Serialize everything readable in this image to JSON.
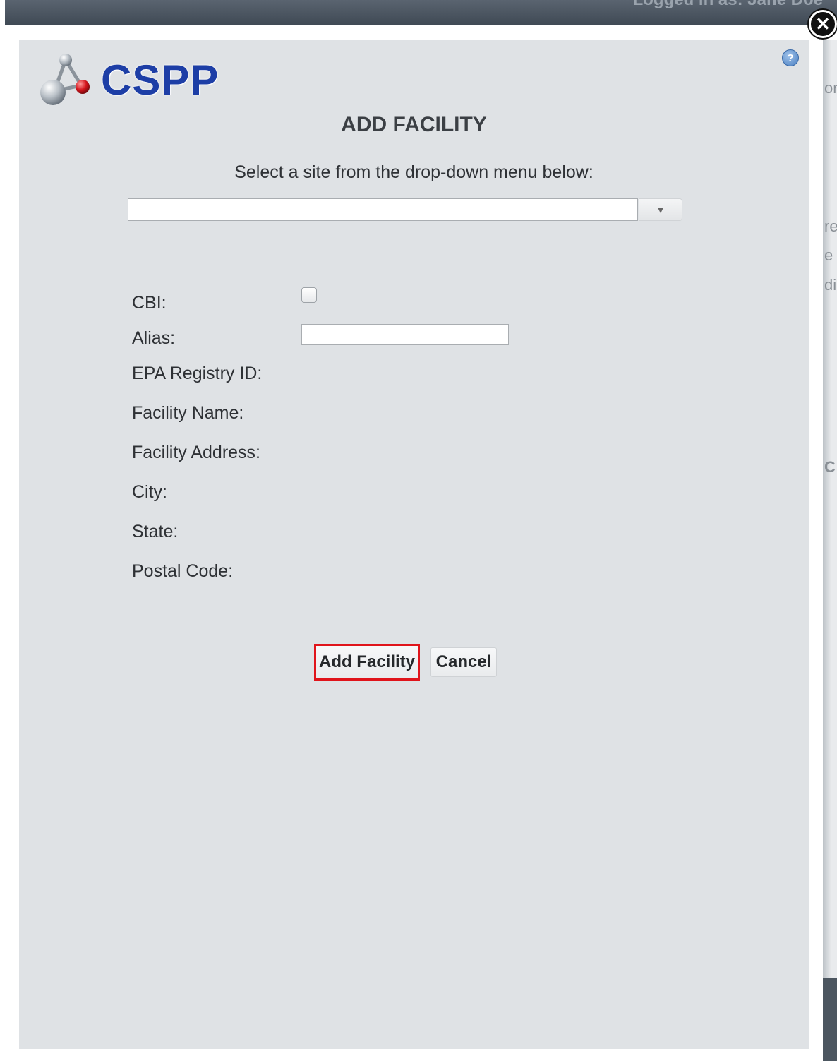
{
  "background": {
    "header_text": "Logged in as: Jane Doe",
    "edge_fragments": [
      "or",
      "re",
      "e t",
      "di",
      "C"
    ]
  },
  "modal": {
    "close_symbol": "✕",
    "help_symbol": "?",
    "logo_text": "CSPP",
    "title": "ADD FACILITY",
    "instruction": "Select a site from the drop-down menu below:",
    "site_select": {
      "value": "",
      "arrow": "▼"
    },
    "fields": {
      "cbi_label": "CBI:",
      "alias_label": "Alias:",
      "alias_value": "",
      "epa_registry_id_label": "EPA Registry ID:",
      "facility_name_label": "Facility Name:",
      "facility_address_label": "Facility Address:",
      "city_label": "City:",
      "state_label": "State:",
      "postal_code_label": "Postal Code:"
    },
    "buttons": {
      "add_label": "Add Facility",
      "cancel_label": "Cancel"
    },
    "colors": {
      "logo_blue": "#1d3ea6",
      "highlight_red": "#e0141b",
      "modal_bg": "#dfe2e5"
    }
  }
}
